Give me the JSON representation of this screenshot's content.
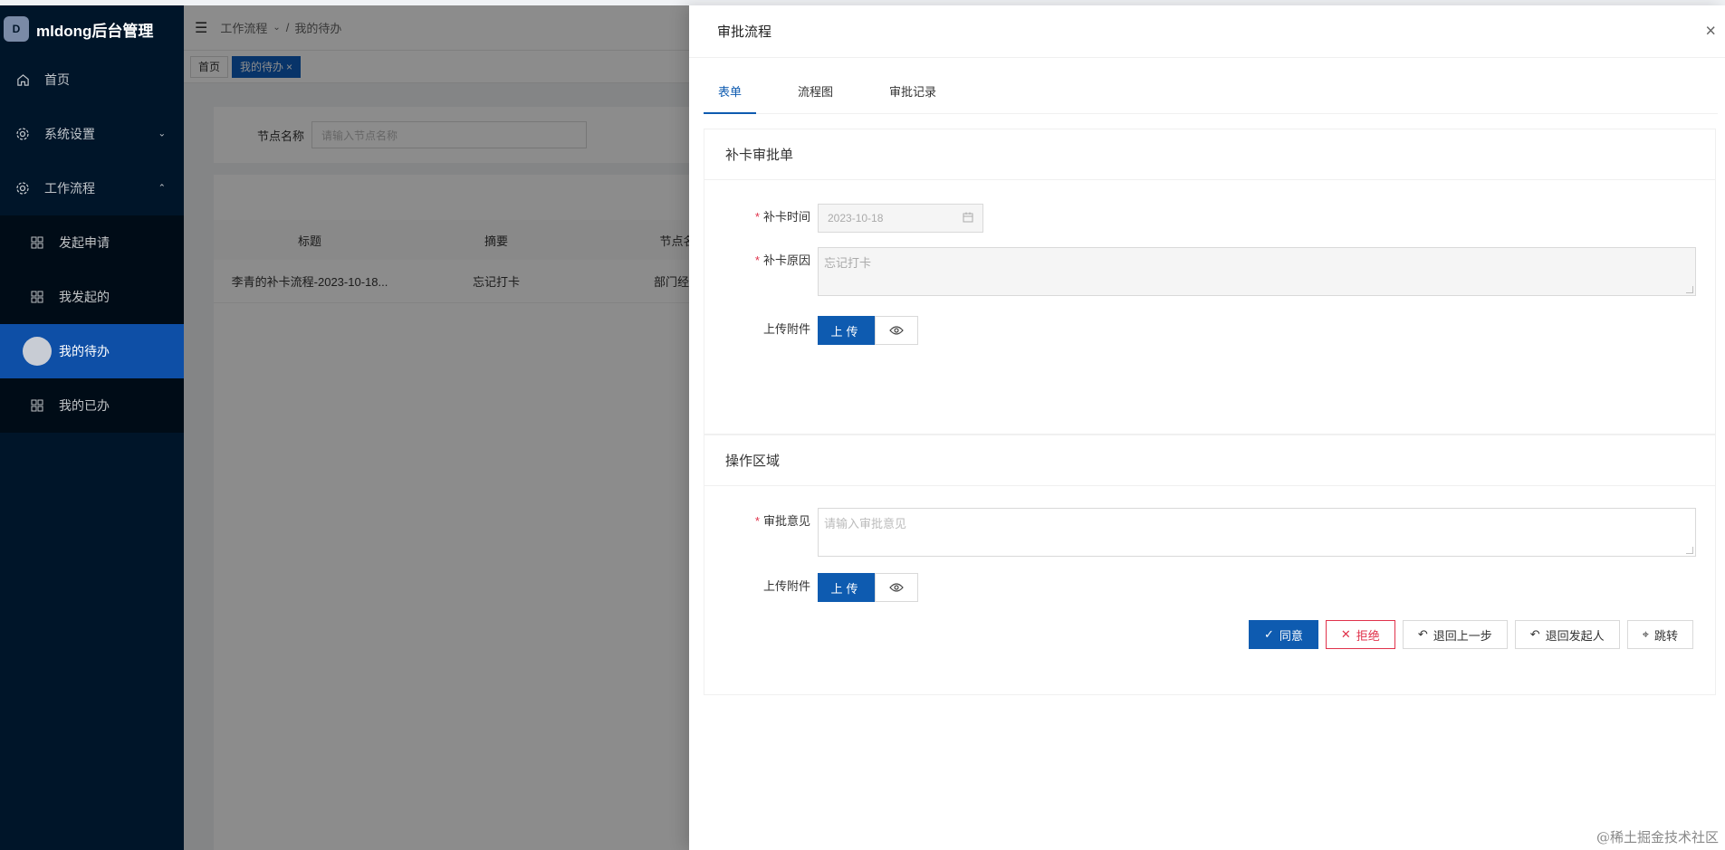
{
  "app": {
    "title": "mldong后台管理",
    "logo_letter": "D"
  },
  "sidebar": {
    "items": [
      {
        "label": "首页",
        "icon": "home-icon"
      },
      {
        "label": "系统设置",
        "icon": "gear-icon"
      },
      {
        "label": "工作流程",
        "icon": "gear-icon"
      }
    ],
    "submenu": [
      {
        "label": "发起申请",
        "icon": "grid-icon"
      },
      {
        "label": "我发起的",
        "icon": "grid-icon"
      },
      {
        "label": "我的待办",
        "icon": "avatar",
        "active": true
      },
      {
        "label": "我的已办",
        "icon": "grid-icon"
      }
    ]
  },
  "breadcrumb": {
    "parent": "工作流程",
    "current": "我的待办",
    "separator": "/"
  },
  "tabs": {
    "home": "首页",
    "todo": "我的待办",
    "close": "×"
  },
  "search": {
    "label": "节点名称",
    "placeholder": "请输入节点名称"
  },
  "table": {
    "headers": [
      "标题",
      "摘要",
      "节点名"
    ],
    "rows": [
      {
        "title": "李青的补卡流程-2023-10-18...",
        "summary": "忘记打卡",
        "node": "部门经理"
      }
    ]
  },
  "drawer": {
    "title": "审批流程",
    "close": "×",
    "tabs": [
      "表单",
      "流程图",
      "审批记录"
    ],
    "form_panel": {
      "title": "补卡审批单",
      "date_label": "补卡时间",
      "date_value": "2023-10-18",
      "reason_label": "补卡原因",
      "reason_value": "忘记打卡",
      "attach_label": "上传附件",
      "upload_label": "上传"
    },
    "action_panel": {
      "title": "操作区域",
      "opinion_label": "审批意见",
      "opinion_placeholder": "请输入审批意见",
      "attach_label": "上传附件",
      "upload_label": "上传",
      "buttons": {
        "agree": "同意",
        "reject": "拒绝",
        "back_prev": "退回上一步",
        "back_starter": "退回发起人",
        "jump": "跳转"
      }
    }
  },
  "watermark": "@稀土掘金技术社区",
  "colors": {
    "primary": "#0e5bb0",
    "danger": "#e0324b",
    "sidebar": "#001529"
  }
}
